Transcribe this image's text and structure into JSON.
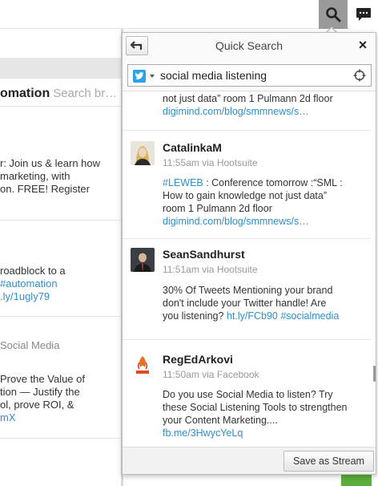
{
  "topbar": {
    "search_icon": "search-icon",
    "message_icon": "message-icon"
  },
  "background": {
    "header_title": "omation",
    "header_search": "Search br…",
    "post1": [
      "r: Join us & learn how",
      "marketing, with",
      "on. FREE! Register"
    ],
    "post2_line1": "roadblock to a",
    "post2_hashtag": "#automation",
    "post2_link": ".ly/1ugly79",
    "post3_meta": "Social Media",
    "post3": [
      "Prove the Value of",
      "tion — Justify the",
      "ol, prove ROI, &"
    ],
    "post3_link": "mX"
  },
  "popup": {
    "title": "Quick Search",
    "back_icon": "back-arrow-icon",
    "close_label": "×",
    "search": {
      "network": "twitter",
      "value": "social media listening"
    },
    "partial_result": {
      "text": "not just data” room 1 Pulmann 2d floor",
      "link": "digimind.com/blog/smmnews/s…"
    },
    "results": [
      {
        "user": "CatalinkaM",
        "time": "11:55am via Hootsuite",
        "hashtag": "#LEWEB",
        "lines": [
          " : Conference tomorrow :“SML :",
          "How to gain knowledge not just data”",
          "room 1 Pulmann 2d floor"
        ],
        "link": "digimind.com/blog/smmnews/s…"
      },
      {
        "user": "SeanSandhurst",
        "time": "11:51am via Hootsuite",
        "lines": [
          "30% Of Tweets Mentioning your brand",
          "don't include your Twitter handle! Are",
          "you listening?"
        ],
        "link": "ht.ly/FCb90",
        "hashtag": "#socialmedia"
      },
      {
        "user": "RegEdArkovi",
        "time": "11:50am via Facebook",
        "lines": [
          "Do you use Social Media to listen? Try",
          "these Social Listening Tools to strengthen",
          "your Content Marketing...."
        ],
        "link": "fb.me/3HwycYeLq"
      }
    ],
    "save_label": "Save as Stream"
  },
  "colors": {
    "link": "#2f8fce",
    "twitter": "#2aa3ef",
    "accent_green": "#5cae3c"
  }
}
